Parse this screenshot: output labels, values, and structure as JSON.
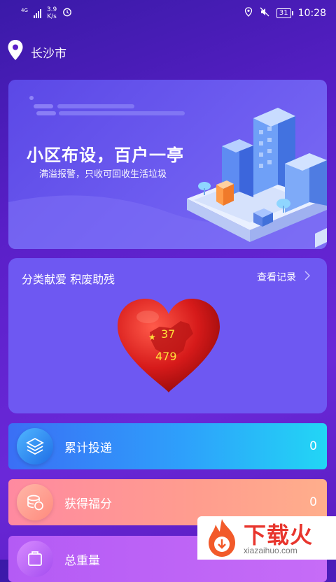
{
  "status_bar": {
    "network": "4G",
    "speed_value": "3.9",
    "speed_unit": "K/s",
    "battery": "31",
    "time": "10:28"
  },
  "location": {
    "city": "长沙市"
  },
  "banner": {
    "title": "小区布设，百户一亭",
    "subtitle": "满溢报警，只收可回收生活垃圾"
  },
  "donation": {
    "title": "分类献爱 积废助残",
    "view_records": "查看记录",
    "heart_num1": "37",
    "heart_num2": "479"
  },
  "stats": [
    {
      "label": "累计投递",
      "value": "0",
      "icon": "layers-icon"
    },
    {
      "label": "获得福分",
      "value": "0",
      "icon": "coins-icon"
    },
    {
      "label": "总重量",
      "value": "",
      "icon": "scale-icon"
    }
  ],
  "watermark": {
    "title": "下载火",
    "url": "xiazaihuo.com"
  },
  "colors": {
    "banner": "#6d5cf0",
    "card": "#6e58f2",
    "heart": "#d61a1a",
    "heart_text": "#ffe23a",
    "watermark_red": "#e8352d"
  }
}
